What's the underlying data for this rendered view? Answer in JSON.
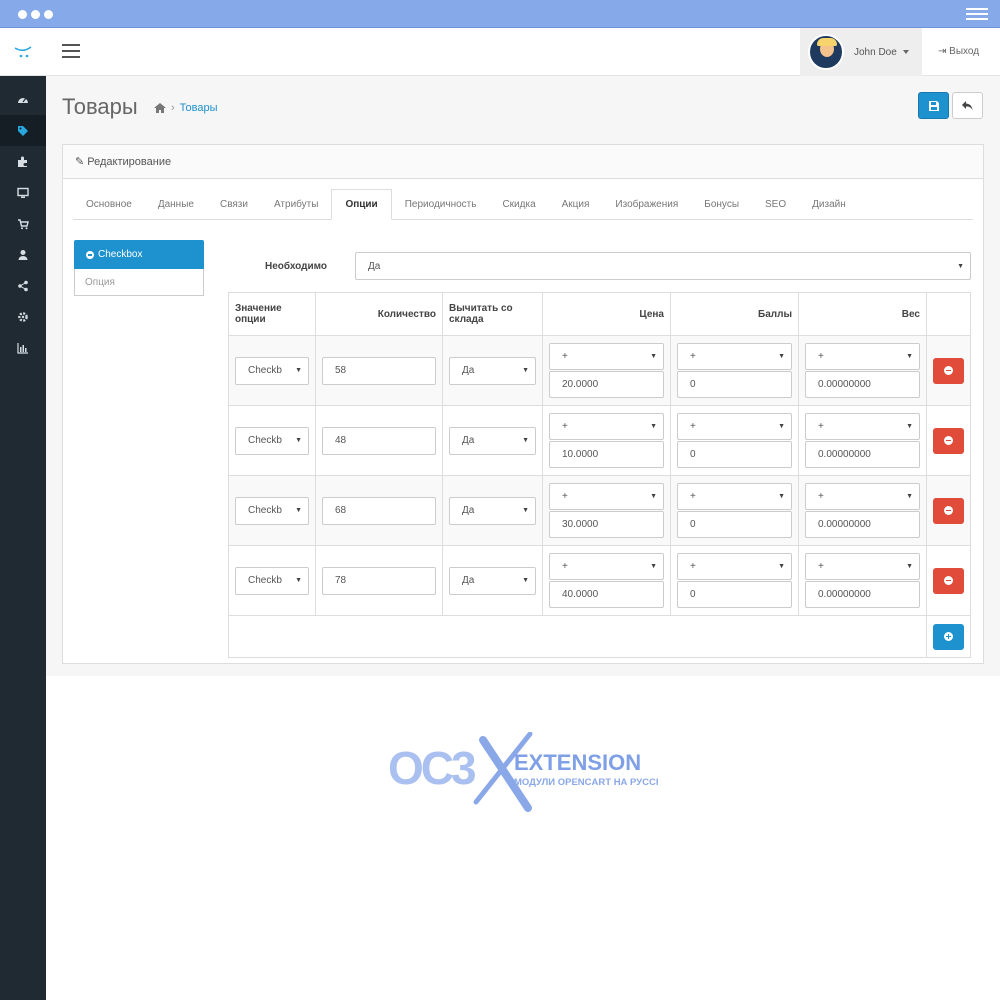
{
  "header": {
    "user_name": "John Doe",
    "logout_label": "Выход"
  },
  "sidebar": {
    "items": [
      {
        "icon": "dashboard-icon",
        "active": false
      },
      {
        "icon": "tags-icon",
        "active": true
      },
      {
        "icon": "puzzle-icon",
        "active": false
      },
      {
        "icon": "desktop-icon",
        "active": false
      },
      {
        "icon": "cart-icon",
        "active": false
      },
      {
        "icon": "user-icon",
        "active": false
      },
      {
        "icon": "share-icon",
        "active": false
      },
      {
        "icon": "gear-icon",
        "active": false
      },
      {
        "icon": "bar-chart-icon",
        "active": false
      }
    ]
  },
  "page": {
    "title": "Товары",
    "breadcrumb": [
      "Товары"
    ]
  },
  "panel": {
    "heading": "Редактирование",
    "tabs": [
      "Основное",
      "Данные",
      "Связи",
      "Атрибуты",
      "Опции",
      "Периодичность",
      "Скидка",
      "Акция",
      "Изображения",
      "Бонусы",
      "SEO",
      "Дизайн"
    ],
    "active_tab": "Опции"
  },
  "options": {
    "active_option": "Checkbox",
    "option_input_placeholder": "Опция",
    "required_label": "Необходимо",
    "required_value": "Да"
  },
  "table": {
    "headers": {
      "value": "Значение опции",
      "quantity": "Количество",
      "subtract": "Вычитать со склада",
      "price": "Цена",
      "points": "Баллы",
      "weight": "Вес"
    },
    "rows": [
      {
        "value": "Checkb",
        "quantity": "58",
        "subtract": "Да",
        "price_prefix": "+",
        "price": "20.0000",
        "points_prefix": "+",
        "points": "0",
        "weight_prefix": "+",
        "weight": "0.00000000"
      },
      {
        "value": "Checkb",
        "quantity": "48",
        "subtract": "Да",
        "price_prefix": "+",
        "price": "10.0000",
        "points_prefix": "+",
        "points": "0",
        "weight_prefix": "+",
        "weight": "0.00000000"
      },
      {
        "value": "Checkb",
        "quantity": "68",
        "subtract": "Да",
        "price_prefix": "+",
        "price": "30.0000",
        "points_prefix": "+",
        "points": "0",
        "weight_prefix": "+",
        "weight": "0.00000000"
      },
      {
        "value": "Checkb",
        "quantity": "78",
        "subtract": "Да",
        "price_prefix": "+",
        "price": "40.0000",
        "points_prefix": "+",
        "points": "0",
        "weight_prefix": "+",
        "weight": "0.00000000"
      }
    ]
  },
  "watermark": {
    "brand_left": "OC3",
    "brand_right": "EXTENSION",
    "tagline": "МОДУЛИ OPENCART НА РУССКОМ"
  },
  "colors": {
    "primary": "#1e91cf",
    "danger": "#e04b3a",
    "sidebar": "#1f2a33",
    "browser_bar": "#85a9e9"
  }
}
